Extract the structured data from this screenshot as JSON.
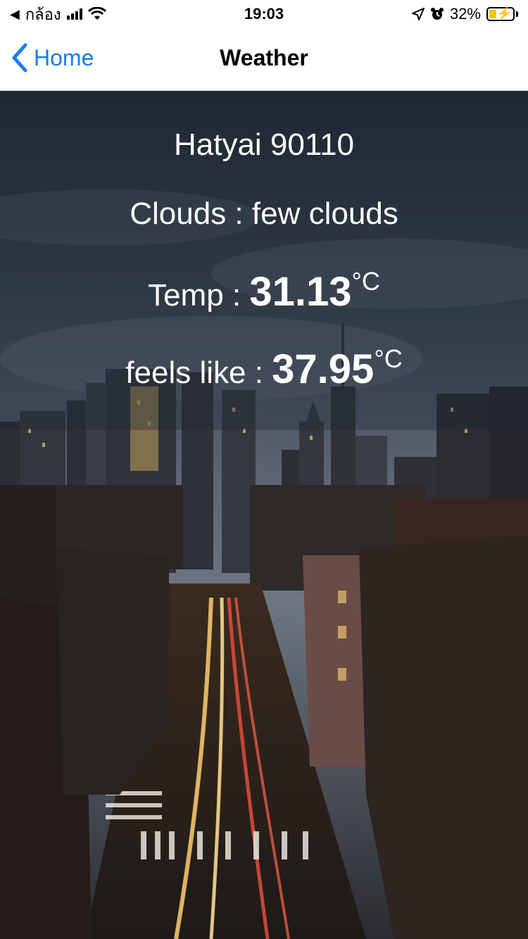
{
  "status_bar": {
    "carrier": "กล้อง",
    "time": "19:03",
    "battery": "32%",
    "icons": [
      "back-arrow-icon",
      "signal-icon",
      "wifi-icon",
      "location-icon",
      "alarm-icon",
      "battery-icon"
    ]
  },
  "nav": {
    "back_label": "Home",
    "title": "Weather"
  },
  "weather": {
    "location": "Hatyai 90110",
    "condition": "Clouds : few clouds",
    "temp_label": "Temp :",
    "temp_value": "31.13",
    "temp_unit": "°C",
    "feels_label": "feels like :",
    "feels_value": "37.95",
    "feels_unit": "°C"
  },
  "colors": {
    "accent": "#1a7df0",
    "battery_fill": "#f5c400"
  }
}
